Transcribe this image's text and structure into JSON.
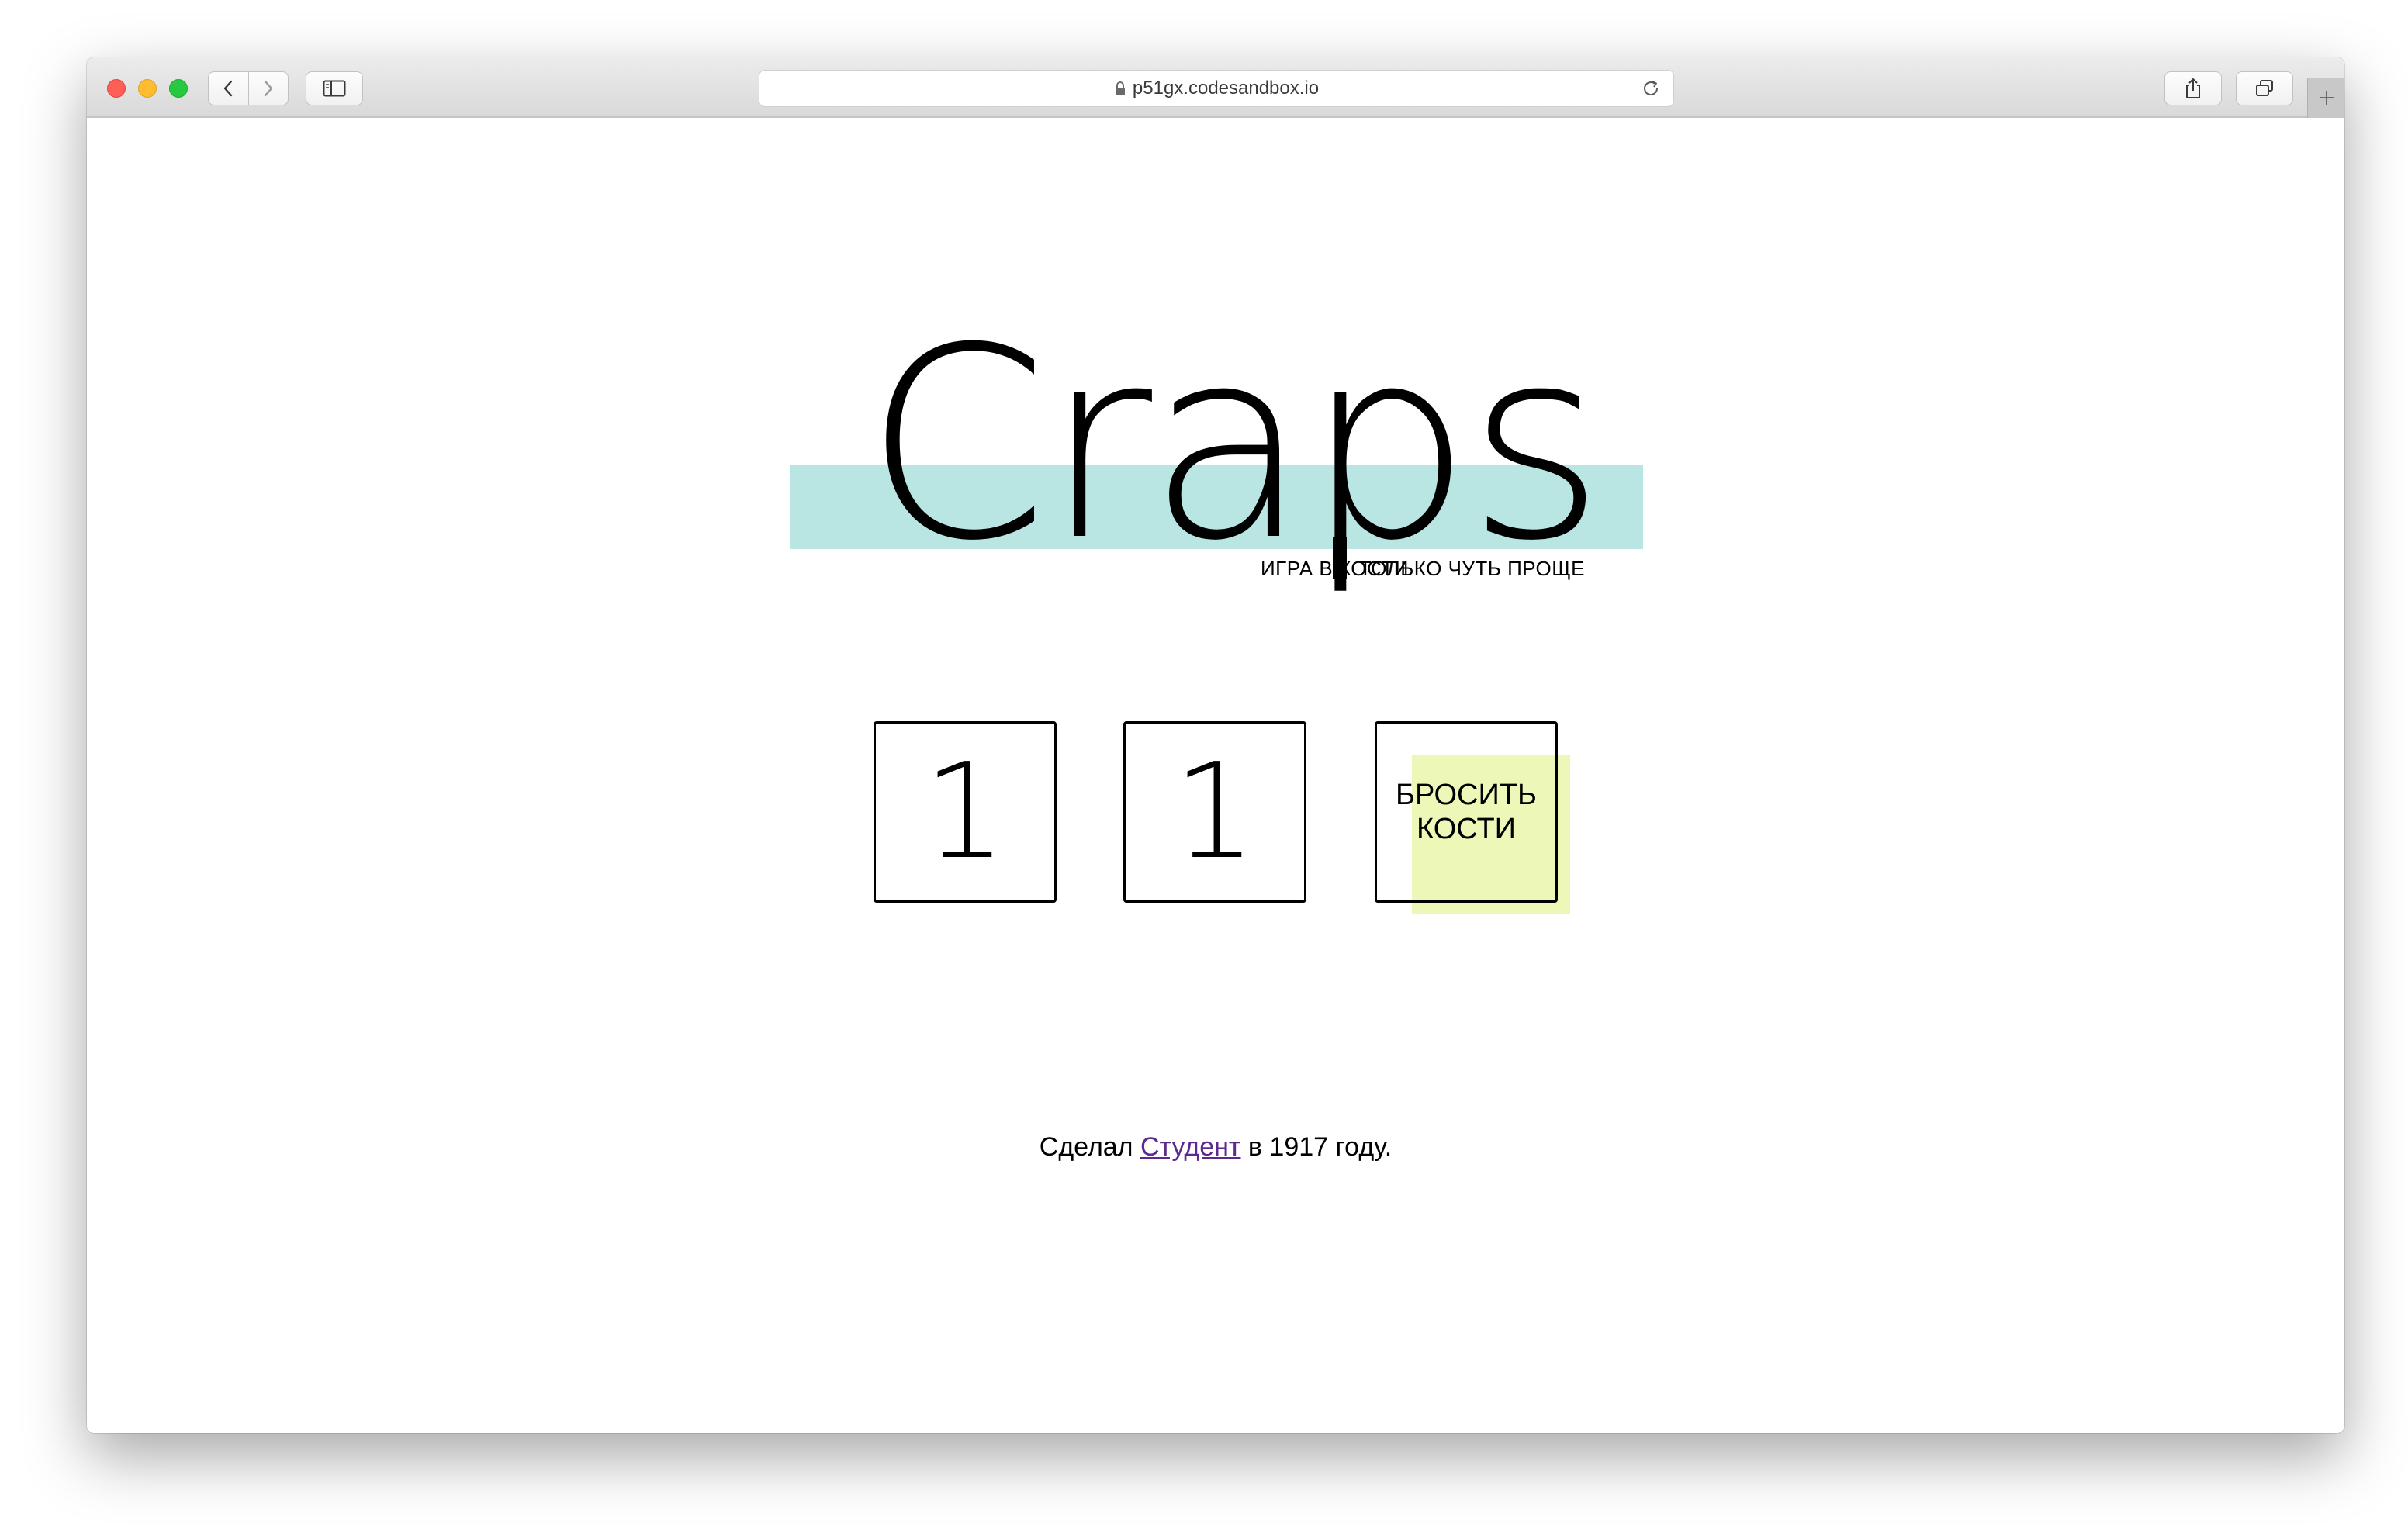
{
  "browser": {
    "url": "p51gx.codesandbox.io",
    "icons": {
      "close": "red-close-icon",
      "minimize": "yellow-minimize-icon",
      "maximize": "green-maximize-icon",
      "back": "chevron-left-icon",
      "forward": "chevron-right-icon",
      "sidebar": "sidebar-icon",
      "lock": "lock-icon",
      "reload": "reload-icon",
      "share": "share-icon",
      "tabs": "tabs-overview-icon",
      "new_tab": "plus-icon"
    }
  },
  "logo": {
    "title": "Craps",
    "subtitle_left": "ИГРА В КОСТИ",
    "subtitle_right": "ТОЛЬКО ЧУТЬ ПРОЩЕ",
    "band_color": "#b9e5e3"
  },
  "dice": {
    "die1": "1",
    "die2": "1"
  },
  "roll_button": {
    "label": "БРОСИТЬ КОСТИ",
    "highlight_color": "#edf8b8"
  },
  "footer": {
    "prefix": "Сделал",
    "link_text": "Студент",
    "suffix": "в 1917 году."
  }
}
